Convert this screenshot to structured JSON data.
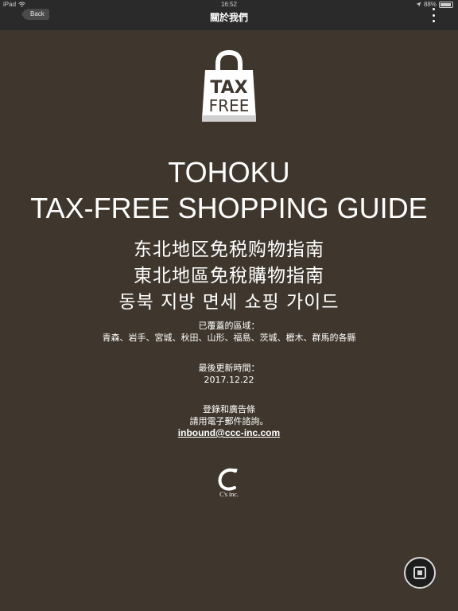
{
  "status_bar": {
    "device": "iPad",
    "time": "16:52",
    "battery": "88%"
  },
  "nav": {
    "back_label": "Back",
    "title": "關於我們"
  },
  "logo": {
    "line1": "TAX",
    "line2": "FREE"
  },
  "title_en": {
    "line1": "TOHOKU",
    "line2": "TAX-FREE SHOPPING GUIDE"
  },
  "title_cjk": {
    "simplified": "东北地区免税购物指南",
    "traditional": "東北地區免稅購物指南",
    "korean": "동북 지방 면세 쇼핑 가이드"
  },
  "coverage": {
    "label": "已覆蓋的區域：",
    "areas": "青森、岩手、宮城、秋田、山形、福島、茨城、櫪木、群馬的各縣"
  },
  "update": {
    "label": "最後更新時間：",
    "date": "2017.12.22"
  },
  "contact": {
    "line1": "登錄和廣告條",
    "line2": "請用電子郵件諮詢。",
    "email": "inbound@ccc-inc.com"
  },
  "company": {
    "name": "C's inc."
  }
}
